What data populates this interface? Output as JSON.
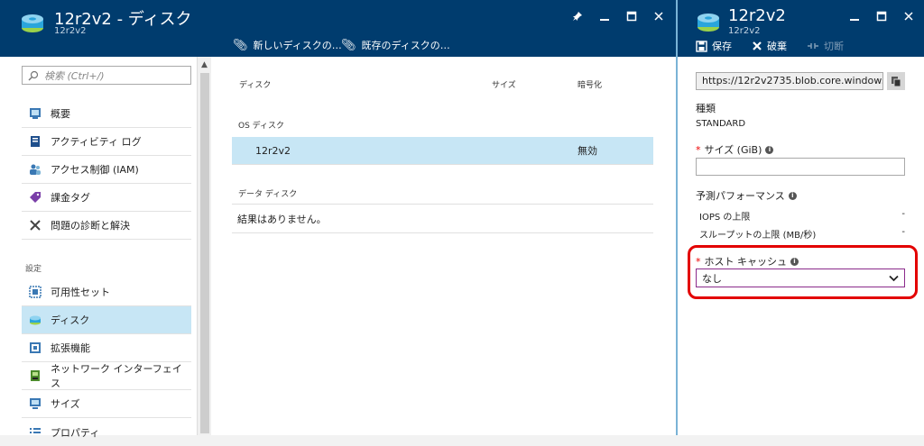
{
  "left_blade": {
    "title": "12r2v2 - ディスク",
    "subtitle": "12r2v2",
    "commands": {
      "new_disk": "新しいディスクの…",
      "existing_disk": "既存のディスクの…"
    },
    "window_icons": [
      "pin-icon",
      "minimize-icon",
      "maximize-icon",
      "close-icon"
    ]
  },
  "sidebar": {
    "search_placeholder": "検索 (Ctrl+/)",
    "items": [
      {
        "label": "概要",
        "icon": "overview-icon",
        "color": "#3a78b4"
      },
      {
        "label": "アクティビティ ログ",
        "icon": "activity-log-icon",
        "color": "#1f4f8c"
      },
      {
        "label": "アクセス制御 (IAM)",
        "icon": "iam-icon",
        "color": "#3a78b4"
      },
      {
        "label": "課金タグ",
        "icon": "tag-icon",
        "color": "#7a3fa8"
      },
      {
        "label": "問題の診断と解決",
        "icon": "tools-icon",
        "color": "#444444"
      }
    ],
    "section_label": "設定",
    "settings_items": [
      {
        "label": "可用性セット",
        "icon": "availability-set-icon",
        "color": "#3a78b4"
      },
      {
        "label": "ディスク",
        "icon": "disk-icon",
        "color": "#2e9ad0"
      },
      {
        "label": "拡張機能",
        "icon": "extensions-icon",
        "color": "#3a78b4"
      },
      {
        "label": "ネットワーク インターフェイス",
        "icon": "network-interface-icon",
        "color": "#4a8a2a"
      },
      {
        "label": "サイズ",
        "icon": "size-icon",
        "color": "#3a78b4"
      },
      {
        "label": "プロパティ",
        "icon": "properties-icon",
        "color": "#3a78b4"
      }
    ]
  },
  "disk_table": {
    "columns": [
      "ディスク",
      "サイズ",
      "暗号化"
    ],
    "os_section": "OS ディスク",
    "os_row": {
      "name": "12r2v2",
      "size": "",
      "encryption": "無効"
    },
    "data_section": "データ ディスク",
    "empty_text": "結果はありません。"
  },
  "right_blade": {
    "title": "12r2v2",
    "subtitle": "12r2v2",
    "commands": {
      "save": "保存",
      "discard": "破棄",
      "detach": "切断"
    },
    "url": "https://12r2v2735.blob.core.windows",
    "type_label": "種類",
    "type_value": "STANDARD",
    "size_label": "サイズ (GiB)",
    "size_value": "",
    "perf_label": "予測パフォーマンス",
    "iops_label": "IOPS の上限",
    "iops_value": "-",
    "throughput_label": "スループットの上限 (MB/秒)",
    "throughput_value": "-",
    "cache_label": "ホスト キャッシュ",
    "cache_value": "なし",
    "required_mark": "*"
  },
  "colors": {
    "header": "#003c6e",
    "selected": "#c7e6f5",
    "highlight": "#e30000"
  }
}
